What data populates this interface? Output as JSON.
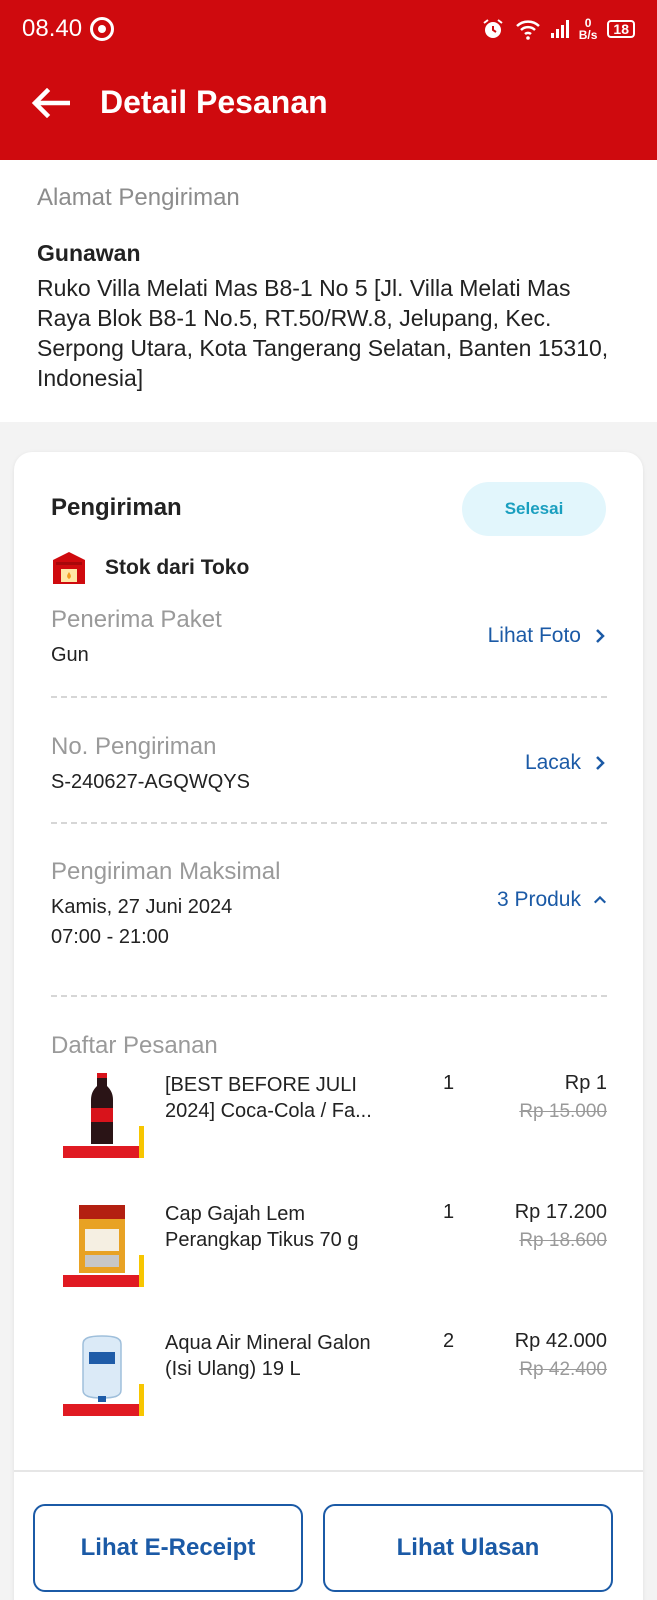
{
  "status_bar": {
    "time": "08.40",
    "net_speed_value": "0",
    "net_speed_unit": "B/s",
    "battery": "18"
  },
  "header": {
    "title": "Detail Pesanan"
  },
  "address": {
    "label": "Alamat Pengiriman",
    "name": "Gunawan",
    "full": "Ruko Villa Melati Mas B8-1 No 5 [Jl. Villa Melati Mas Raya Blok B8-1 No.5, RT.50/RW.8, Jelupang, Kec. Serpong Utara, Kota Tangerang Selatan, Banten 15310, Indonesia]"
  },
  "shipping": {
    "title": "Pengiriman",
    "status": "Selesai",
    "store_label": "Stok dari Toko",
    "recipient": {
      "label": "Penerima Paket",
      "value": "Gun",
      "link": "Lihat Foto"
    },
    "tracking": {
      "label": "No. Pengiriman",
      "value": "S-240627-AGQWQYS",
      "link": "Lacak"
    },
    "max_delivery": {
      "label": "Pengiriman Maksimal",
      "date": "Kamis, 27 Juni 2024",
      "time": "07:00 - 21:00",
      "link": "3 Produk"
    }
  },
  "order_list": {
    "title": "Daftar Pesanan",
    "items": [
      {
        "name": "[BEST BEFORE JULI 2024] Coca-Cola / Fa...",
        "qty": "1",
        "price": "Rp 1",
        "old_price": "Rp 15.000"
      },
      {
        "name": "Cap Gajah Lem Perangkap Tikus 70 g",
        "qty": "1",
        "price": "Rp 17.200",
        "old_price": "Rp 18.600"
      },
      {
        "name": "Aqua Air Mineral Galon (Isi Ulang) 19 L",
        "qty": "2",
        "price": "Rp 42.000",
        "old_price": "Rp 42.400"
      }
    ]
  },
  "buttons": {
    "receipt": "Lihat E-Receipt",
    "review": "Lihat Ulasan"
  },
  "colors": {
    "brand_red": "#cf0a0e",
    "link_blue": "#1b5aa6",
    "badge_bg": "#e2f6fc",
    "badge_text": "#1a9fbf"
  }
}
